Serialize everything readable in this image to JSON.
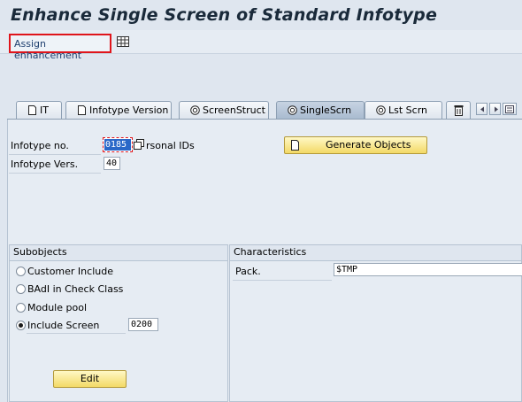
{
  "window": {
    "title": "Enhance Single Screen of Standard Infotype"
  },
  "toolbar": {
    "assign_label": "Assign enhancement"
  },
  "tabs": [
    {
      "label": "IT",
      "icon": "document-icon"
    },
    {
      "label": "Infotype Version",
      "icon": "document-icon"
    },
    {
      "label": "ScreenStruct",
      "icon": "screen-icon"
    },
    {
      "label": "SingleScrn",
      "icon": "screen-icon",
      "active": true
    },
    {
      "label": "Lst Scrn",
      "icon": "screen-icon"
    }
  ],
  "form": {
    "infotype_no_label": "Infotype no.",
    "infotype_no_value": "0185",
    "infotype_text": "rsonal IDs",
    "infotype_vers_label": "Infotype Vers.",
    "infotype_vers_value": "40",
    "generate_label": "Generate Objects"
  },
  "subobjects": {
    "title": "Subobjects",
    "options": [
      {
        "label": "Customer Include",
        "selected": false
      },
      {
        "label": "BAdI in Check Class",
        "selected": false
      },
      {
        "label": "Module pool",
        "selected": false
      },
      {
        "label": "Include Screen",
        "selected": true
      }
    ],
    "include_screen_value": "0200",
    "edit_label": "Edit"
  },
  "characteristics": {
    "title": "Characteristics",
    "pack_label": "Pack.",
    "pack_value": "$TMP"
  },
  "colors": {
    "highlight": "#e0151b",
    "selected_field": "#2a68c8",
    "button": "#f3d966"
  }
}
